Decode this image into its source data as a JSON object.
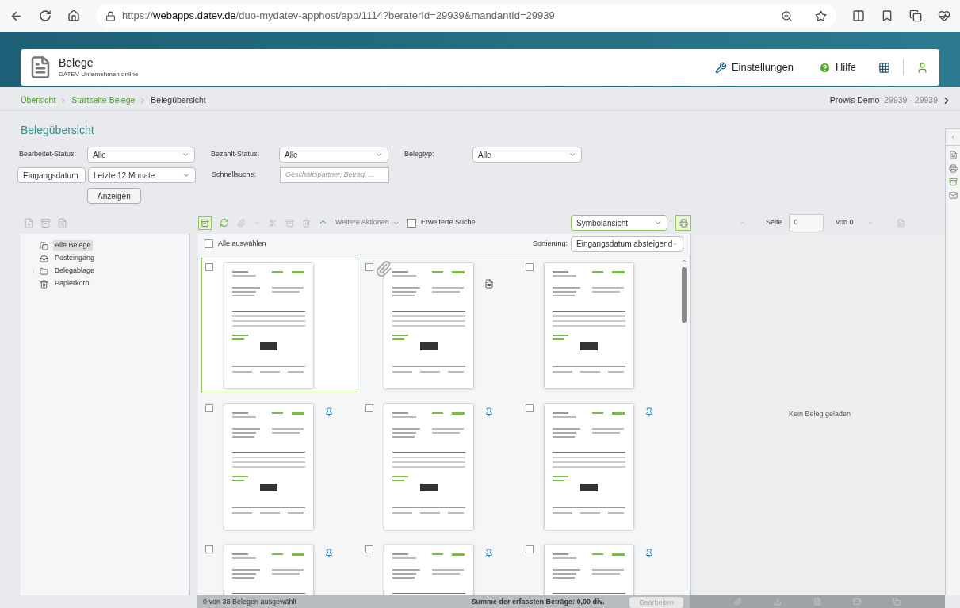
{
  "browser": {
    "url_prefix": "https://",
    "url_host": "webapps.datev.de",
    "url_path": "/duo-mydatev-apphost/app/1114?beraterId=29939&mandantId=29939"
  },
  "app_header": {
    "title": "Belege",
    "subtitle": "DATEV Unternehmen online",
    "settings": "Einstellungen",
    "help": "Hilfe"
  },
  "breadcrumb": [
    {
      "label": "Übersicht",
      "current": false
    },
    {
      "label": "Startseite Belege",
      "current": false
    },
    {
      "label": "Belegübersicht",
      "current": true
    }
  ],
  "client": {
    "name": "Prowis Demo",
    "number": "29939 - 29939"
  },
  "page_title": "Belegübersicht",
  "filters": {
    "bearbeitet_label": "Bearbeitet-Status:",
    "bearbeitet_value": "Alle",
    "bezahlt_label": "Bezahlt-Status:",
    "bezahlt_value": "Alle",
    "belegtyp_label": "Belegtyp:",
    "belegtyp_value": "Alle",
    "date_field": "Eingangsdatum",
    "date_range": "Letzte 12 Monate",
    "search_label": "Schnellsuche:",
    "search_placeholder": "Geschäftspartner, Betrag, ...",
    "show_button": "Anzeigen"
  },
  "tree": [
    {
      "label": "Alle Belege",
      "selected": true,
      "expandable": false
    },
    {
      "label": "Posteingang",
      "selected": false,
      "expandable": false
    },
    {
      "label": "Belegablage",
      "selected": false,
      "expandable": true
    },
    {
      "label": "Papierkorb",
      "selected": false,
      "expandable": false
    }
  ],
  "toolbar": {
    "more_actions": "Weitere Aktionen",
    "extended_search": "Erweiterte Suche",
    "extended_search_checked": false,
    "view": "Symbolansicht"
  },
  "list": {
    "select_all": "Alle auswählen",
    "select_all_checked": false,
    "sort_label": "Sortierung:",
    "sort_value": "Eingangsdatum absteigend"
  },
  "documents": [
    {
      "selected": true,
      "checked": false,
      "pinned": false,
      "attachment": false,
      "note": false
    },
    {
      "selected": false,
      "checked": false,
      "pinned": false,
      "attachment": true,
      "note": true
    },
    {
      "selected": false,
      "checked": false,
      "pinned": false,
      "attachment": false,
      "note": false
    },
    {
      "selected": false,
      "checked": false,
      "pinned": true,
      "attachment": false,
      "note": false
    },
    {
      "selected": false,
      "checked": false,
      "pinned": true,
      "attachment": false,
      "note": false
    },
    {
      "selected": false,
      "checked": false,
      "pinned": true,
      "attachment": false,
      "note": false
    },
    {
      "selected": false,
      "checked": false,
      "pinned": true,
      "attachment": false,
      "note": false
    },
    {
      "selected": false,
      "checked": false,
      "pinned": true,
      "attachment": false,
      "note": false
    },
    {
      "selected": false,
      "checked": false,
      "pinned": true,
      "attachment": false,
      "note": false
    }
  ],
  "viewer": {
    "page_label": "Seite",
    "page_value": "0",
    "page_of": "von 0",
    "empty": "Kein Beleg geladen"
  },
  "status_bar": {
    "selection": "0 von 38 Belegen ausgewählt",
    "sum": "Summe der erfassten Beträge: 0,00 div.",
    "edit_button": "Bearbeiten"
  }
}
